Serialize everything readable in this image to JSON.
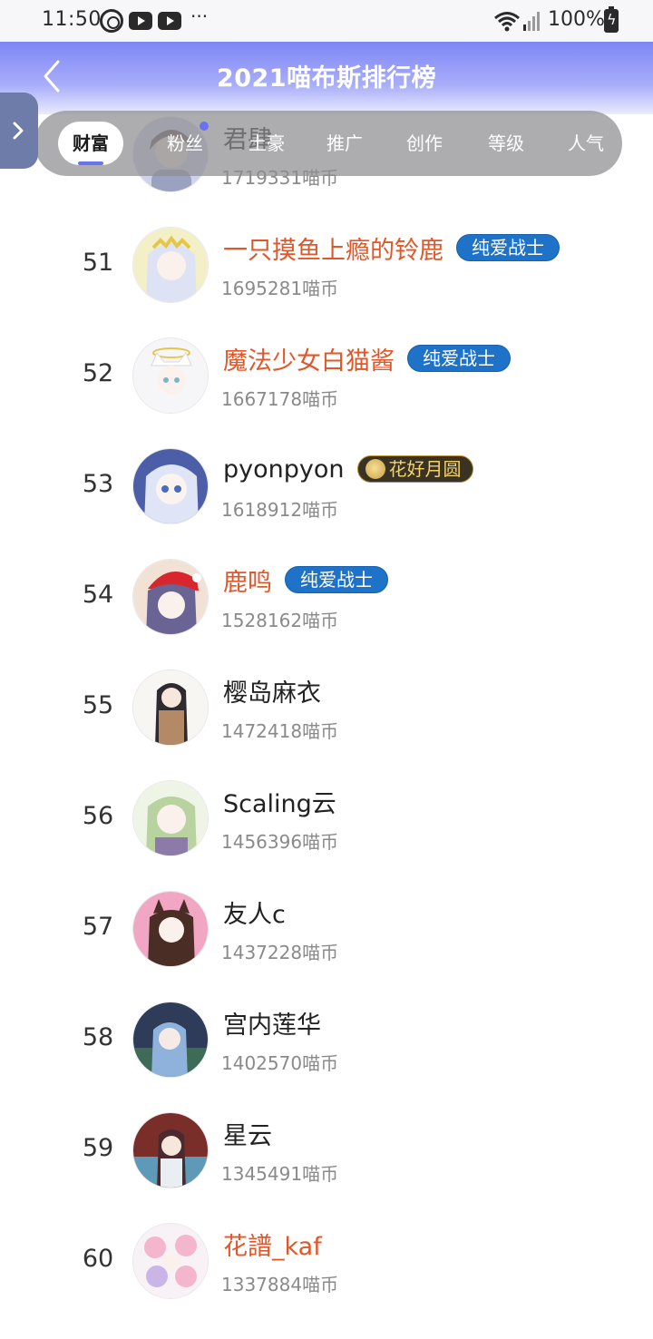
{
  "status_bar": {
    "time": "11:50",
    "battery": "100%",
    "more": "···"
  },
  "header": {
    "title": "2021喵布斯排行榜"
  },
  "tabs": [
    {
      "label": "财富",
      "active": true
    },
    {
      "label": "粉丝",
      "active": false
    },
    {
      "label": "土豪",
      "active": false
    },
    {
      "label": "推广",
      "active": false
    },
    {
      "label": "创作",
      "active": false
    },
    {
      "label": "等级",
      "active": false
    },
    {
      "label": "人气",
      "active": false
    }
  ],
  "colors": {
    "header_accent": "#7e86f5",
    "vip_name": "#e0572a",
    "badge_blue": "#1e72c8",
    "badge_gold_text": "#f4d36a"
  },
  "rows": [
    {
      "rank": "",
      "name": "君肆",
      "coins": "1719331喵币",
      "badge": "",
      "avatar_color": "#cfd2e8"
    },
    {
      "rank": "51",
      "name": "一只摸鱼上瘾的铃鹿",
      "coins": "1695281喵币",
      "badge": "纯爱战士",
      "avatar_color": "#e8ecfa"
    },
    {
      "rank": "52",
      "name": "魔法少女白猫酱",
      "coins": "1667178喵币",
      "badge": "纯爱战士",
      "avatar_color": "#f2f4f8"
    },
    {
      "rank": "53",
      "name": "pyonpyon",
      "coins": "1618912喵币",
      "badge": "花好月圆",
      "avatar_color": "#7083c8"
    },
    {
      "rank": "54",
      "name": "鹿鸣",
      "coins": "1528162喵币",
      "badge": "纯爱战士",
      "avatar_color": "#f4e6de"
    },
    {
      "rank": "55",
      "name": "樱岛麻衣",
      "coins": "1472418喵币",
      "badge": "",
      "avatar_color": "#f5f2ee"
    },
    {
      "rank": "56",
      "name": "Scaling云",
      "coins": "1456396喵币",
      "badge": "",
      "avatar_color": "#e8f1e0"
    },
    {
      "rank": "57",
      "name": "友人c",
      "coins": "1437228喵币",
      "badge": "",
      "avatar_color": "#f0a8c4"
    },
    {
      "rank": "58",
      "name": "宫内莲华",
      "coins": "1402570喵币",
      "badge": "",
      "avatar_color": "#3a4a6a"
    },
    {
      "rank": "59",
      "name": "星云",
      "coins": "1345491喵币",
      "badge": "",
      "avatar_color": "#8aa0b8"
    },
    {
      "rank": "60",
      "name": "花譜_kaf",
      "coins": "1337884喵币",
      "badge": "",
      "avatar_color": "#f6eef2"
    }
  ]
}
